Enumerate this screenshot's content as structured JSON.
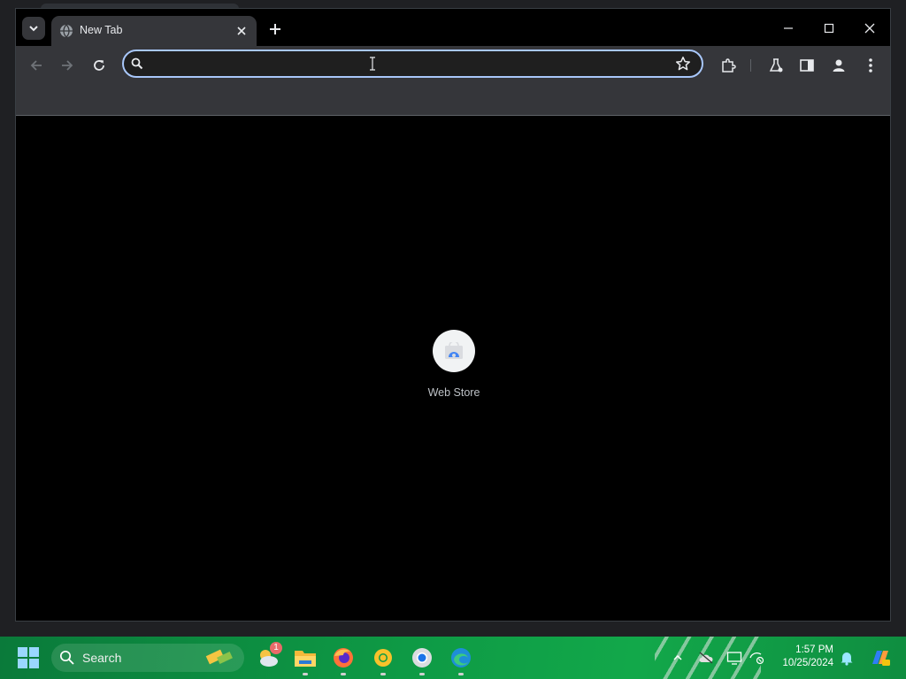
{
  "browser": {
    "tab": {
      "title": "New Tab",
      "favicon": "globe-icon"
    },
    "omnibox": {
      "value": "",
      "placeholder": ""
    },
    "toolbar_icons": [
      "back-icon",
      "forward-icon",
      "reload-icon",
      "extensions-icon",
      "labs-icon",
      "side-panel-icon",
      "profile-icon",
      "menu-icon"
    ],
    "accent": "#a8c7fa"
  },
  "newtab": {
    "shortcuts": [
      {
        "label": "Web Store"
      }
    ]
  },
  "taskbar": {
    "search_label": "Search",
    "badge_count": "1",
    "apps": [
      "weather-icon",
      "file-explorer-icon",
      "firefox-icon",
      "chrome-canary-icon",
      "chrome-icon",
      "edge-icon"
    ],
    "clock": {
      "time": "1:57 PM",
      "date": "10/25/2024"
    },
    "color": "#0e9a45"
  }
}
